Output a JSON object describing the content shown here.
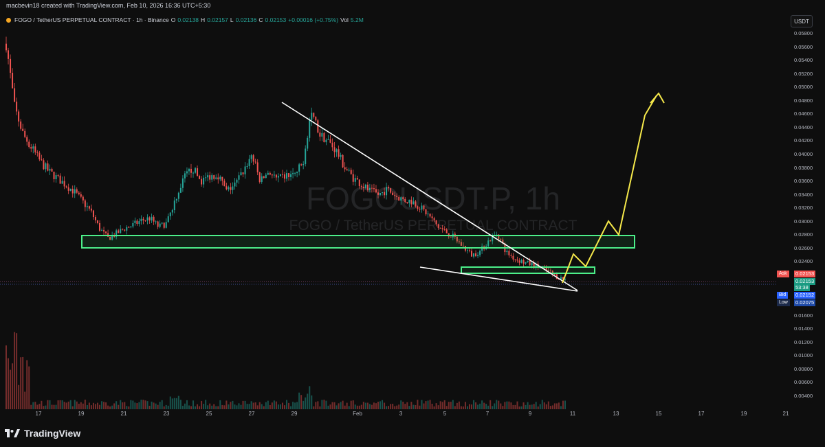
{
  "header": {
    "credit": "macbevin18 created with TradingView.com, Feb 10, 2026 16:36 UTC+5:30",
    "symbol": "FOGO / TetherUS PERPETUAL CONTRACT · 1h · Binance",
    "open_label": "O",
    "open_value": "0.02138",
    "high_label": "H",
    "high_value": "0.02157",
    "low_label": "L",
    "low_value": "0.02136",
    "close_label": "C",
    "close_value": "0.02153",
    "change": "+0.00016 (+0.75%)",
    "vol_label": "Vol",
    "vol_value": "5.2M"
  },
  "currency_button": "USDT",
  "watermark": {
    "line1": "FOGOUSDT.P, 1h",
    "line2": "FOGO / TetherUS PERPETUAL CONTRACT"
  },
  "price_axis": [
    "0.05800",
    "0.05600",
    "0.05400",
    "0.05200",
    "0.05000",
    "0.04800",
    "0.04600",
    "0.04400",
    "0.04200",
    "0.04000",
    "0.03800",
    "0.03600",
    "0.03400",
    "0.03200",
    "0.03000",
    "0.02800",
    "0.02600",
    "0.02400",
    "0.01600",
    "0.01400",
    "0.01200",
    "0.01000",
    "0.00800",
    "0.00600",
    "0.00400"
  ],
  "price_labels": {
    "ask_tag": "Ask",
    "ask_value": "0.02153",
    "last_value": "0.02153",
    "countdown": "53:38",
    "bid_tag": "Bid",
    "bid_value": "0.02152",
    "low_tag": "Low",
    "low_value": "0.02075"
  },
  "date_axis": [
    "17",
    "19",
    "21",
    "23",
    "25",
    "27",
    "29",
    "Feb",
    "3",
    "5",
    "7",
    "9",
    "11",
    "13",
    "15",
    "17",
    "19",
    "21"
  ],
  "brand": "TradingView",
  "colors": {
    "up": "#26a69a",
    "down": "#ef5350",
    "zone": "#4cf08a",
    "projection": "#f5e84a",
    "trendline": "#ffffff",
    "ask": "#f05350",
    "bid": "#2962ff"
  },
  "chart_data": {
    "type": "candlestick",
    "title": "FOGOUSDT.P, 1h",
    "approx_close_series": [
      0.0565,
      0.047,
      0.043,
      0.041,
      0.039,
      0.0375,
      0.0365,
      0.0355,
      0.0345,
      0.033,
      0.0315,
      0.029,
      0.0275,
      0.0282,
      0.029,
      0.0295,
      0.0302,
      0.0305,
      0.0292,
      0.0298,
      0.0335,
      0.0365,
      0.038,
      0.036,
      0.0368,
      0.037,
      0.0345,
      0.0355,
      0.0375,
      0.04,
      0.036,
      0.0375,
      0.0362,
      0.0368,
      0.037,
      0.0385,
      0.0465,
      0.043,
      0.042,
      0.0405,
      0.038,
      0.0365,
      0.0355,
      0.0345,
      0.034,
      0.0348,
      0.0338,
      0.0332,
      0.033,
      0.032,
      0.0308,
      0.0292,
      0.0284,
      0.0275,
      0.0262,
      0.025,
      0.0256,
      0.0272,
      0.0283,
      0.0255,
      0.0245,
      0.024,
      0.0236,
      0.0232,
      0.0226,
      0.0218,
      0.0214
    ],
    "ylim": [
      0.003,
      0.059
    ],
    "annotations": [
      {
        "type": "zone",
        "from": 0.0265,
        "to": 0.0282
      },
      {
        "type": "zone",
        "from": 0.0232,
        "to": 0.0238
      },
      {
        "type": "trendline",
        "from": 0.048,
        "to": 0.0206
      },
      {
        "type": "trendline",
        "from": 0.0243,
        "to": 0.0206
      },
      {
        "type": "projection",
        "from": 0.0215,
        "to": 0.0495
      }
    ]
  }
}
